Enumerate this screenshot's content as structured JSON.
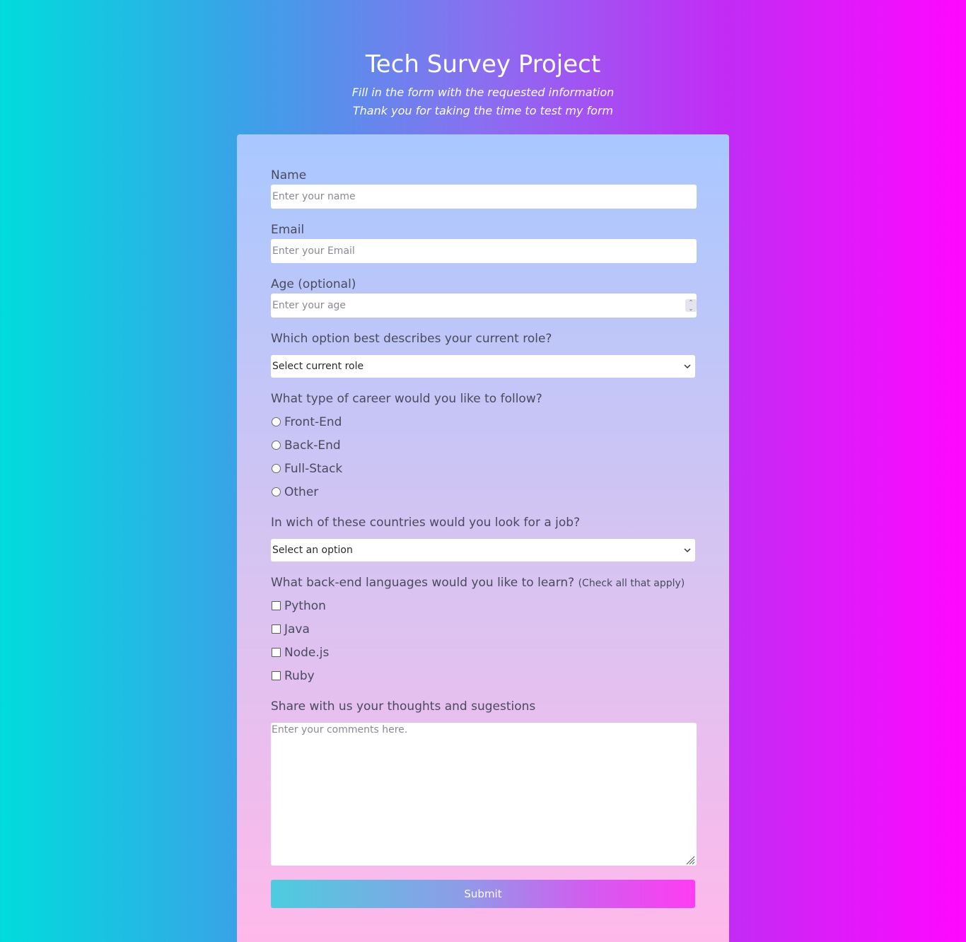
{
  "header": {
    "title": "Tech Survey Project",
    "subtitle_line1": "Fill in the form with the requested information",
    "subtitle_line2": "Thank you for taking the time to test my form"
  },
  "form": {
    "name": {
      "label": "Name",
      "placeholder": "Enter your name",
      "value": ""
    },
    "email": {
      "label": "Email",
      "placeholder": "Enter your Email",
      "value": ""
    },
    "age": {
      "label": "Age (optional)",
      "placeholder": "Enter your age",
      "value": ""
    },
    "role": {
      "label": "Which option best describes your current role?",
      "selected": "Select current role"
    },
    "career": {
      "label": "What type of career would you like to follow?",
      "options": [
        "Front-End",
        "Back-End",
        "Full-Stack",
        "Other"
      ]
    },
    "country": {
      "label": "In wich of these countries would you look for a job?",
      "selected": "Select an option"
    },
    "languages": {
      "label": "What back-end languages would you like to learn?",
      "hint": "(Check all that apply)",
      "options": [
        "Python",
        "Java",
        "Node.js",
        "Ruby"
      ]
    },
    "comments": {
      "label": "Share with us your thoughts and sugestions",
      "placeholder": "Enter your comments here."
    },
    "submit_label": "Submit"
  },
  "icons": {
    "select_chevron": "chevron-down-icon",
    "number_spinner": "spinner-icon",
    "textarea_resize": "resize-handle-icon"
  },
  "colors": {
    "page_gradient_left": "#00dcdc",
    "page_gradient_right": "#ff07fe",
    "card_gradient_top": "#a9c8ff",
    "card_gradient_bottom": "#ffb9ea"
  }
}
